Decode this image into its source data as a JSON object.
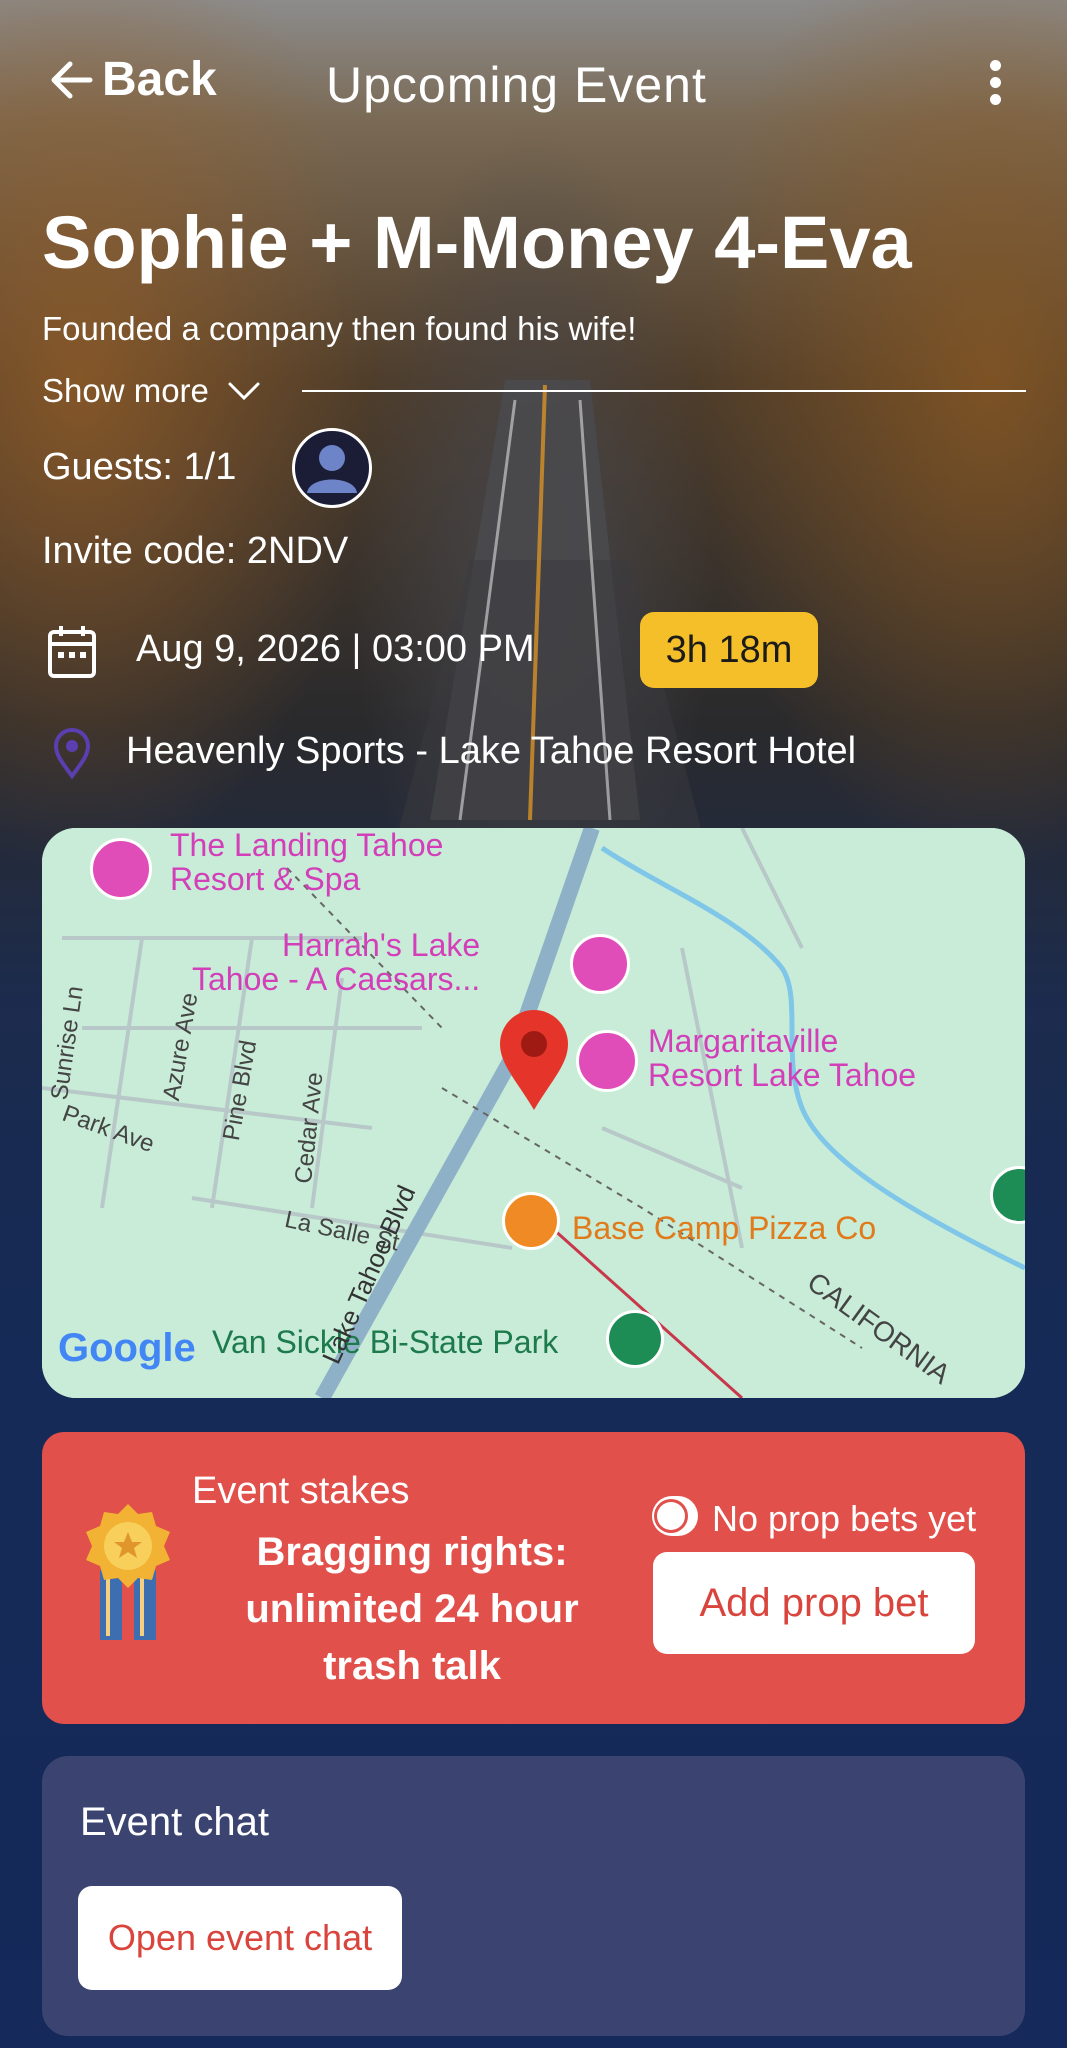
{
  "header": {
    "back_label": "Back",
    "title": "Upcoming Event"
  },
  "event": {
    "name": "Sophie + M-Money 4-Eva",
    "description": "Founded a company then found his wife!",
    "show_more_label": "Show more",
    "guests_text": "Guests: 1/1",
    "invite_text": "Invite code: 2NDV",
    "datetime": "Aug 9, 2026 | 03:00 PM",
    "countdown": "3h 18m",
    "location": "Heavenly Sports - Lake Tahoe Resort Hotel"
  },
  "map": {
    "pois": {
      "landing_1": "The Landing Tahoe",
      "landing_2": "Resort & Spa",
      "harrahs_1": "Harrah's Lake",
      "harrahs_2": "Tahoe - A Caesars...",
      "margaritaville_1": "Margaritaville",
      "margaritaville_2": "Resort Lake Tahoe",
      "basecamp": "Base Camp Pizza Co",
      "vansickle": "Van Sickle Bi-State Park",
      "california": "CALIFORNIA"
    },
    "streets": {
      "sunrise": "Sunrise Ln",
      "azure": "Azure Ave",
      "pine": "Pine Blvd",
      "park": "Park Ave",
      "cedar": "Cedar Ave",
      "lasalle": "La Salle St",
      "laketahoe": "Lake Tahoe Blvd"
    },
    "attribution": "Google"
  },
  "stakes": {
    "label": "Event stakes",
    "text": "Bragging rights: unlimited 24 hour trash talk",
    "prop_bets_status": "No prop bets yet",
    "add_button": "Add prop bet"
  },
  "chat": {
    "label": "Event chat",
    "open_button": "Open event chat"
  },
  "colors": {
    "countdown_bg": "#f5bf29",
    "stakes_bg": "#e1504a",
    "chat_bg": "#3b4470",
    "button_text": "#d9453d",
    "pin_purple": "#5b3fb0"
  },
  "icons": [
    "back-arrow-icon",
    "more-vertical-icon",
    "chevron-down-icon",
    "user-avatar-icon",
    "calendar-icon",
    "location-pin-icon",
    "medal-icon",
    "toggle-icon",
    "map-marker-icon"
  ]
}
